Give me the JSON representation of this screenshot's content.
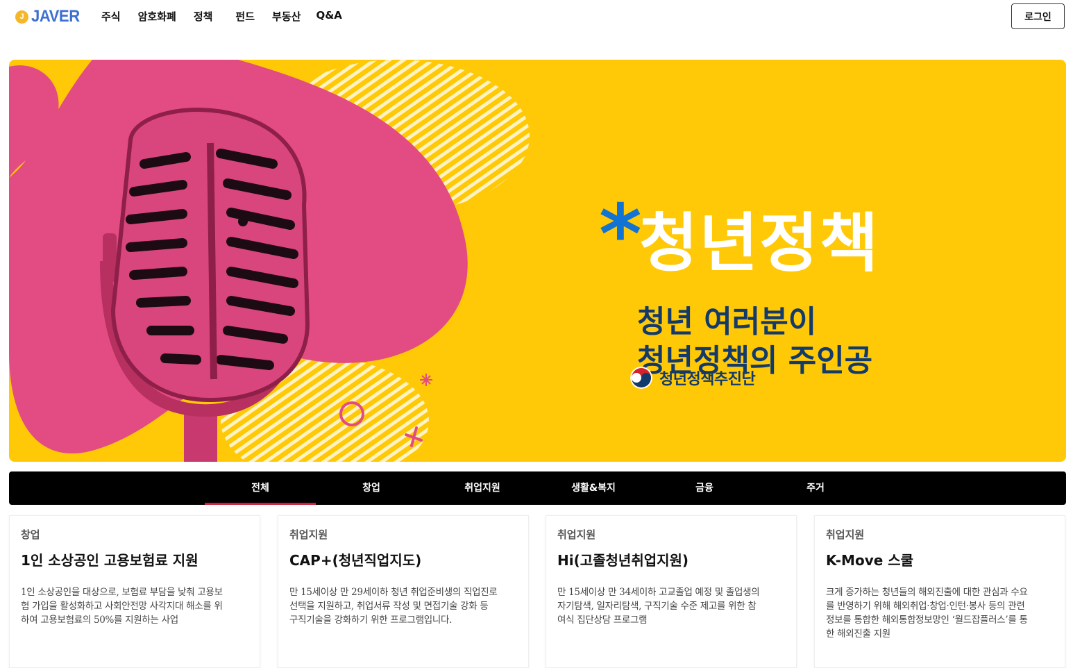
{
  "header": {
    "logo_mark": "J",
    "logo_text": "JAVER",
    "nav": [
      {
        "label": "주식"
      },
      {
        "label": "암호화폐"
      },
      {
        "label": "정책"
      },
      {
        "label": "펀드"
      },
      {
        "label": "부동산"
      },
      {
        "label": "Q&A"
      }
    ],
    "login_label": "로그인"
  },
  "banner": {
    "title_star": "*",
    "title": "청년정책",
    "subtitle_line1": "청년 여러분이",
    "subtitle_line2": "청년정책의 주인공",
    "org_name": "청년정책추진단",
    "colors": {
      "background": "#ffc907",
      "pink": "#e24c83",
      "title_blue": "#1173d4",
      "navy": "#133a6a"
    }
  },
  "tabs": [
    {
      "label": "전체",
      "active": true
    },
    {
      "label": "창업",
      "active": false
    },
    {
      "label": "취업지원",
      "active": false
    },
    {
      "label": "생활&복지",
      "active": false
    },
    {
      "label": "금융",
      "active": false
    },
    {
      "label": "주거",
      "active": false
    }
  ],
  "cards": [
    {
      "category": "창업",
      "title": "1인 소상공인 고용보험료 지원",
      "desc_lines": [
        "1인 소상공인을 대상으로, 보험료 부담을 낮춰 고용보",
        "험 가입을 활성화하고 사회안전망 사각지대 해소를 위",
        "하여 고용보험료의 50%를 지원하는 사업"
      ]
    },
    {
      "category": "취업지원",
      "title": "CAP+(청년직업지도)",
      "desc_lines": [
        "만 15세이상 만 29세이하 청년 취업준비생의 직업진로",
        "선택을 지원하고, 취업서류 작성 및 면접기술 강화 등",
        "구직기술을 강화하기 위한 프로그램입니다."
      ]
    },
    {
      "category": "취업지원",
      "title": "Hi(고졸청년취업지원)",
      "desc_lines": [
        "만 15세이상 만 34세이하 고교졸업 예정 및 졸업생의",
        "자기탐색, 일자리탐색, 구직기술 수준 제고를 위한 참",
        "여식 집단상담 프로그램"
      ]
    },
    {
      "category": "취업지원",
      "title": "K-Move 스쿨",
      "desc_lines": [
        "크게 증가하는 청년들의 해외진출에 대한 관심과 수요",
        "를 반영하기 위해 해외취업·창업·인턴·봉사 등의 관련",
        "정보를 통합한 해외통합정보망인 ‘월드잡플러스’를 통",
        "한 해외진출 지원"
      ]
    }
  ],
  "accent": {
    "tab_active_underline": "#c8233f",
    "logo_blue": "#3d6fd1",
    "logo_coin": "#f5b72a"
  }
}
